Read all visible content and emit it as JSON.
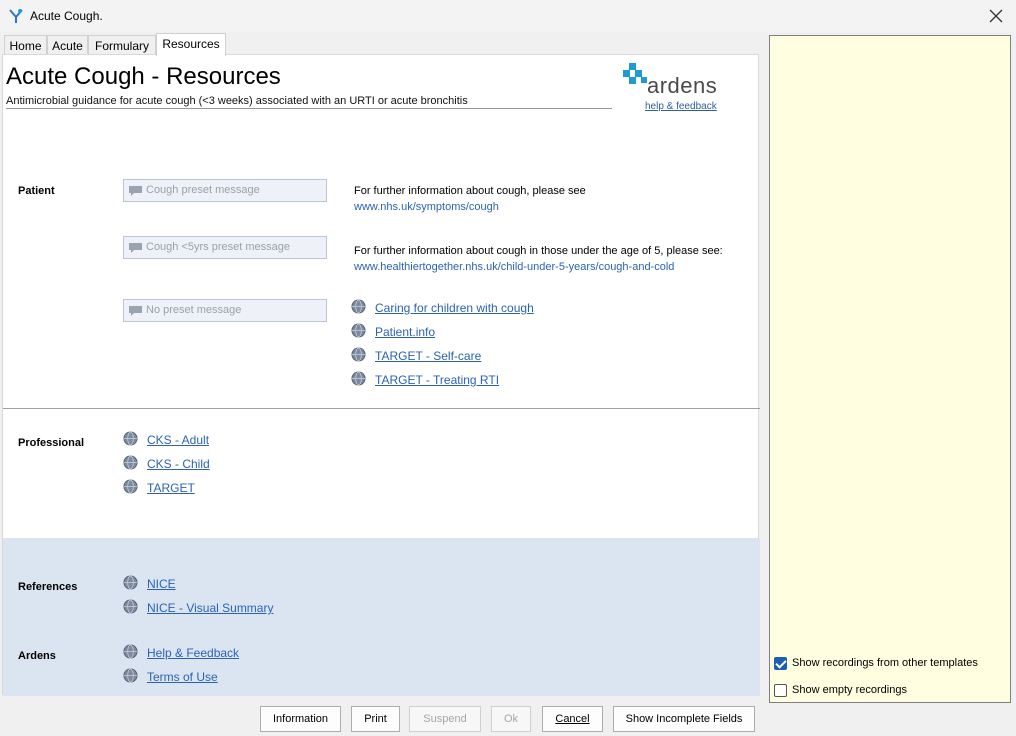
{
  "window": {
    "title": "Acute Cough."
  },
  "tabs": [
    {
      "label": "Home"
    },
    {
      "label": "Acute"
    },
    {
      "label": "Formulary"
    },
    {
      "label": "Resources"
    }
  ],
  "header": {
    "title": "Acute Cough - Resources",
    "subtitle": "Antimicrobial guidance for acute cough (<3 weeks) associated with an URTI or acute bronchitis",
    "logo_text": "ardens",
    "help_link": "help & feedback"
  },
  "patient": {
    "label": "Patient",
    "messages": [
      {
        "placeholder": "Cough preset message"
      },
      {
        "placeholder": "Cough <5yrs preset message"
      },
      {
        "placeholder": "No preset message"
      }
    ],
    "info1": {
      "text": "For further information about cough, please see",
      "link": "www.nhs.uk/symptoms/cough"
    },
    "info2": {
      "text": "For further information about cough in those under the age of 5, please see:",
      "link": "www.healthiertogether.nhs.uk/child-under-5-years/cough-and-cold"
    },
    "links": [
      {
        "label": "Caring for children with cough"
      },
      {
        "label": "Patient.info"
      },
      {
        "label": "TARGET - Self-care"
      },
      {
        "label": "TARGET - Treating RTI"
      }
    ]
  },
  "professional": {
    "label": "Professional",
    "links": [
      {
        "label": "CKS - Adult "
      },
      {
        "label": "CKS - Child "
      },
      {
        "label": "TARGET"
      }
    ]
  },
  "references": {
    "label": "References",
    "links": [
      {
        "label": "NICE"
      },
      {
        "label": "NICE - Visual Summary"
      }
    ]
  },
  "ardens": {
    "label": "Ardens",
    "links": [
      {
        "label": "Help & Feedback"
      },
      {
        "label": "Terms of Use"
      }
    ]
  },
  "side_panel": {
    "show_other_templates": {
      "label": "Show recordings from other templates",
      "checked": true
    },
    "show_empty": {
      "label": "Show empty recordings",
      "checked": false
    }
  },
  "footer": {
    "information": "Information",
    "print": "Print",
    "suspend": "Suspend",
    "ok": "Ok",
    "cancel": "Cancel",
    "show_incomplete": "Show Incomplete Fields"
  },
  "colors": {
    "link": "#2b63b2",
    "logo_blue": "#1e9bd7",
    "refs_background": "#dbe5f1",
    "side_panel_background": "#fffee0"
  }
}
